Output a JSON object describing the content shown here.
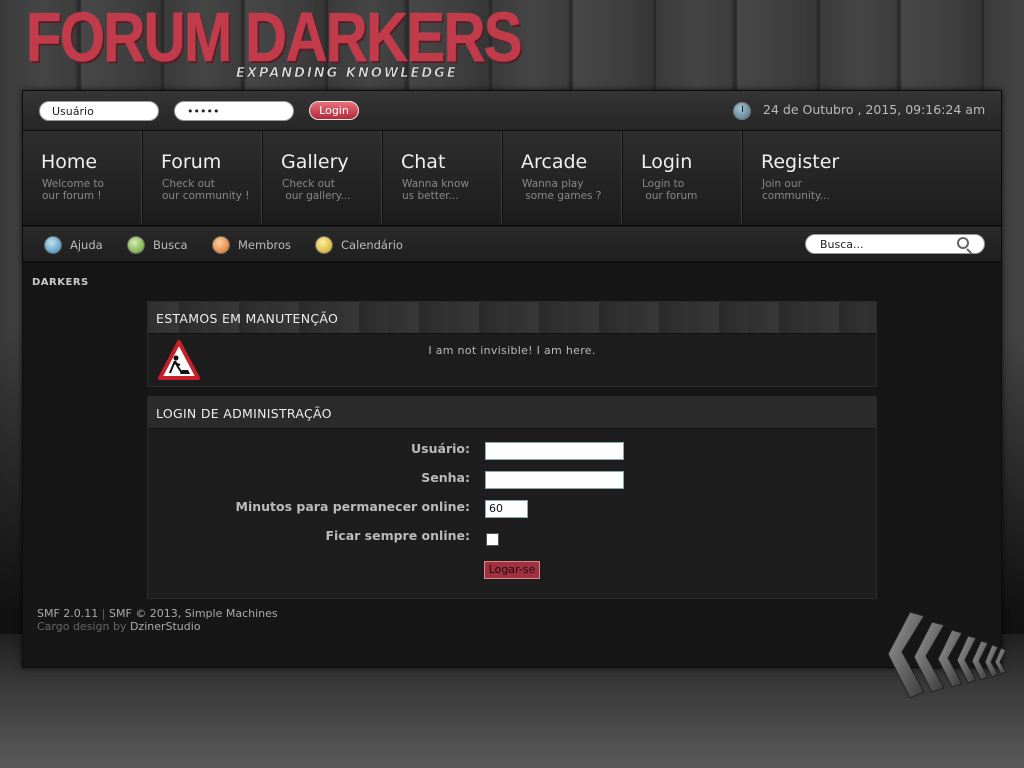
{
  "logo": {
    "title": "FORUM DARKERS",
    "subtitle": "EXPANDING KNOWLEDGE"
  },
  "topbar": {
    "username_value": "Usuário",
    "password_value": "•••••",
    "login_label": "Login",
    "datetime": "24 de Outubro , 2015, 09:16:24 am"
  },
  "nav": {
    "items": [
      {
        "title": "Home",
        "desc": "Welcome to\nour forum !"
      },
      {
        "title": "Forum",
        "desc": "Check out\nour community !"
      },
      {
        "title": "Gallery",
        "desc": "Check out\n our gallery..."
      },
      {
        "title": "Chat",
        "desc": "Wanna know\nus better..."
      },
      {
        "title": "Arcade",
        "desc": "Wanna play\n some games ?"
      },
      {
        "title": "Login",
        "desc": "Login to\n our forum"
      },
      {
        "title": "Register",
        "desc": "Join our\ncommunity..."
      }
    ]
  },
  "subbar": {
    "help": "Ajuda",
    "search": "Busca",
    "members": "Membros",
    "calendar": "Calendário",
    "search_placeholder": "Busca..."
  },
  "breadcrumb": "DARKERS",
  "maintenance": {
    "header": "ESTAMOS EM MANUTENÇÃO",
    "message": "I am not invisible! I am here."
  },
  "admin_login": {
    "header": "LOGIN DE ADMINISTRAÇÃO",
    "user_label": "Usuário:",
    "pass_label": "Senha:",
    "minutes_label": "Minutos para permanecer online:",
    "minutes_value": "60",
    "always_label": "Ficar sempre online:",
    "submit_label": "Logar-se"
  },
  "footer": {
    "version": "SMF 2.0.11",
    "separator": "|",
    "copyright": "SMF © 2013, Simple Machines",
    "theme_name": "Cargo",
    "design_by": "design by",
    "designer": "DzinerStudio"
  },
  "colors": {
    "accent": "#c23b4a",
    "panel": "#161616"
  }
}
